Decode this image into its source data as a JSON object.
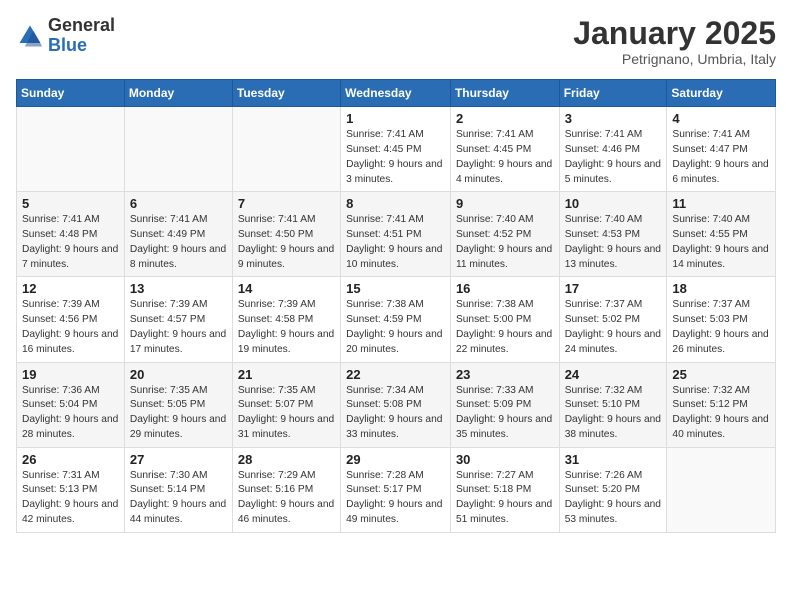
{
  "header": {
    "logo_general": "General",
    "logo_blue": "Blue",
    "title": "January 2025",
    "subtitle": "Petrignano, Umbria, Italy"
  },
  "weekdays": [
    "Sunday",
    "Monday",
    "Tuesday",
    "Wednesday",
    "Thursday",
    "Friday",
    "Saturday"
  ],
  "weeks": [
    [
      {
        "day": "",
        "info": ""
      },
      {
        "day": "",
        "info": ""
      },
      {
        "day": "",
        "info": ""
      },
      {
        "day": "1",
        "info": "Sunrise: 7:41 AM\nSunset: 4:45 PM\nDaylight: 9 hours and 3 minutes."
      },
      {
        "day": "2",
        "info": "Sunrise: 7:41 AM\nSunset: 4:45 PM\nDaylight: 9 hours and 4 minutes."
      },
      {
        "day": "3",
        "info": "Sunrise: 7:41 AM\nSunset: 4:46 PM\nDaylight: 9 hours and 5 minutes."
      },
      {
        "day": "4",
        "info": "Sunrise: 7:41 AM\nSunset: 4:47 PM\nDaylight: 9 hours and 6 minutes."
      }
    ],
    [
      {
        "day": "5",
        "info": "Sunrise: 7:41 AM\nSunset: 4:48 PM\nDaylight: 9 hours and 7 minutes."
      },
      {
        "day": "6",
        "info": "Sunrise: 7:41 AM\nSunset: 4:49 PM\nDaylight: 9 hours and 8 minutes."
      },
      {
        "day": "7",
        "info": "Sunrise: 7:41 AM\nSunset: 4:50 PM\nDaylight: 9 hours and 9 minutes."
      },
      {
        "day": "8",
        "info": "Sunrise: 7:41 AM\nSunset: 4:51 PM\nDaylight: 9 hours and 10 minutes."
      },
      {
        "day": "9",
        "info": "Sunrise: 7:40 AM\nSunset: 4:52 PM\nDaylight: 9 hours and 11 minutes."
      },
      {
        "day": "10",
        "info": "Sunrise: 7:40 AM\nSunset: 4:53 PM\nDaylight: 9 hours and 13 minutes."
      },
      {
        "day": "11",
        "info": "Sunrise: 7:40 AM\nSunset: 4:55 PM\nDaylight: 9 hours and 14 minutes."
      }
    ],
    [
      {
        "day": "12",
        "info": "Sunrise: 7:39 AM\nSunset: 4:56 PM\nDaylight: 9 hours and 16 minutes."
      },
      {
        "day": "13",
        "info": "Sunrise: 7:39 AM\nSunset: 4:57 PM\nDaylight: 9 hours and 17 minutes."
      },
      {
        "day": "14",
        "info": "Sunrise: 7:39 AM\nSunset: 4:58 PM\nDaylight: 9 hours and 19 minutes."
      },
      {
        "day": "15",
        "info": "Sunrise: 7:38 AM\nSunset: 4:59 PM\nDaylight: 9 hours and 20 minutes."
      },
      {
        "day": "16",
        "info": "Sunrise: 7:38 AM\nSunset: 5:00 PM\nDaylight: 9 hours and 22 minutes."
      },
      {
        "day": "17",
        "info": "Sunrise: 7:37 AM\nSunset: 5:02 PM\nDaylight: 9 hours and 24 minutes."
      },
      {
        "day": "18",
        "info": "Sunrise: 7:37 AM\nSunset: 5:03 PM\nDaylight: 9 hours and 26 minutes."
      }
    ],
    [
      {
        "day": "19",
        "info": "Sunrise: 7:36 AM\nSunset: 5:04 PM\nDaylight: 9 hours and 28 minutes."
      },
      {
        "day": "20",
        "info": "Sunrise: 7:35 AM\nSunset: 5:05 PM\nDaylight: 9 hours and 29 minutes."
      },
      {
        "day": "21",
        "info": "Sunrise: 7:35 AM\nSunset: 5:07 PM\nDaylight: 9 hours and 31 minutes."
      },
      {
        "day": "22",
        "info": "Sunrise: 7:34 AM\nSunset: 5:08 PM\nDaylight: 9 hours and 33 minutes."
      },
      {
        "day": "23",
        "info": "Sunrise: 7:33 AM\nSunset: 5:09 PM\nDaylight: 9 hours and 35 minutes."
      },
      {
        "day": "24",
        "info": "Sunrise: 7:32 AM\nSunset: 5:10 PM\nDaylight: 9 hours and 38 minutes."
      },
      {
        "day": "25",
        "info": "Sunrise: 7:32 AM\nSunset: 5:12 PM\nDaylight: 9 hours and 40 minutes."
      }
    ],
    [
      {
        "day": "26",
        "info": "Sunrise: 7:31 AM\nSunset: 5:13 PM\nDaylight: 9 hours and 42 minutes."
      },
      {
        "day": "27",
        "info": "Sunrise: 7:30 AM\nSunset: 5:14 PM\nDaylight: 9 hours and 44 minutes."
      },
      {
        "day": "28",
        "info": "Sunrise: 7:29 AM\nSunset: 5:16 PM\nDaylight: 9 hours and 46 minutes."
      },
      {
        "day": "29",
        "info": "Sunrise: 7:28 AM\nSunset: 5:17 PM\nDaylight: 9 hours and 49 minutes."
      },
      {
        "day": "30",
        "info": "Sunrise: 7:27 AM\nSunset: 5:18 PM\nDaylight: 9 hours and 51 minutes."
      },
      {
        "day": "31",
        "info": "Sunrise: 7:26 AM\nSunset: 5:20 PM\nDaylight: 9 hours and 53 minutes."
      },
      {
        "day": "",
        "info": ""
      }
    ]
  ]
}
